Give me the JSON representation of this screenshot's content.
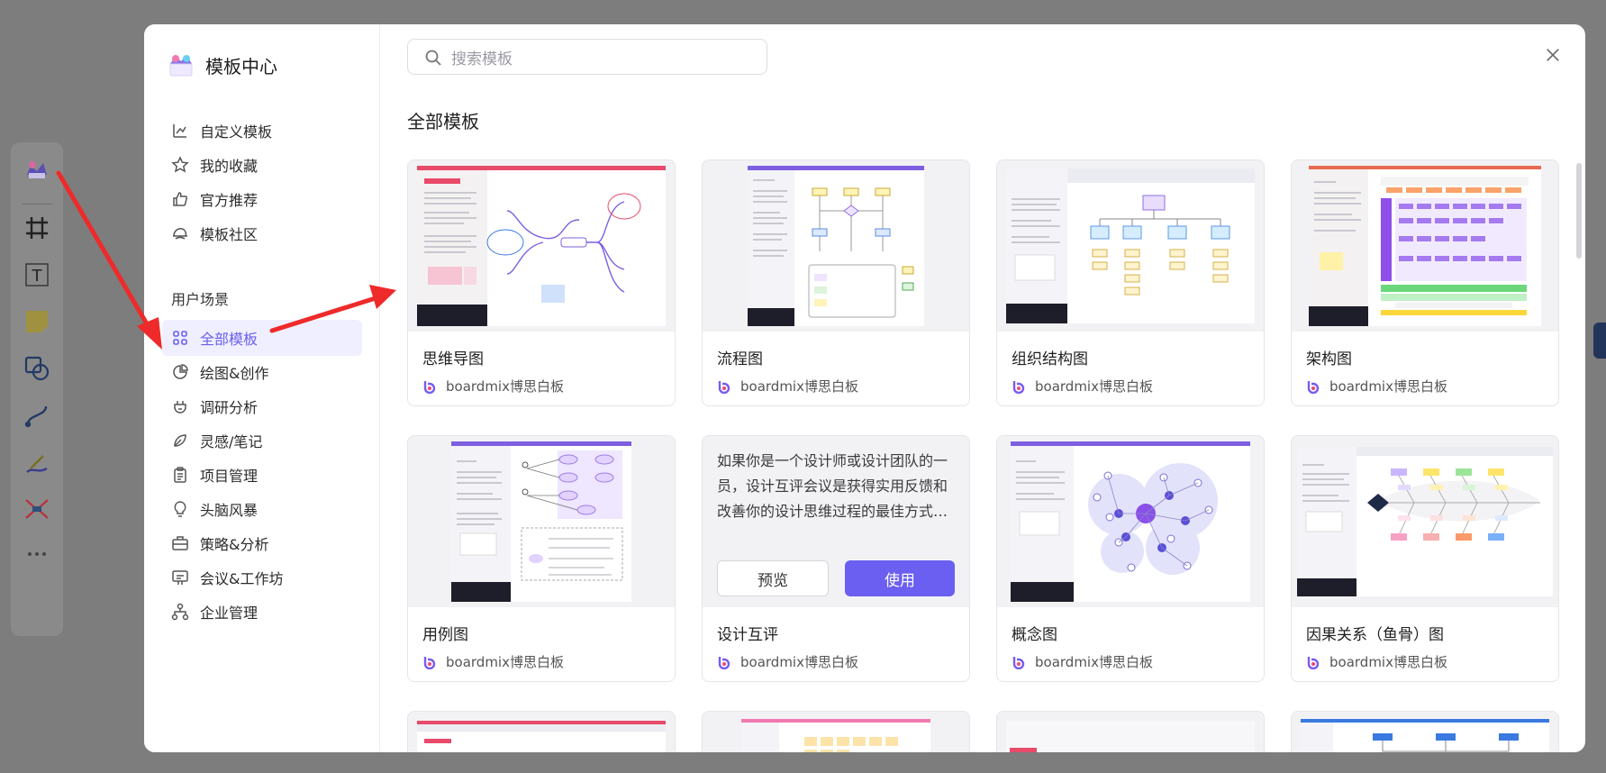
{
  "colors": {
    "accent": "#6a5ff0",
    "accent_bg": "#f0efff",
    "annotation_arrow": "#ee2a2a"
  },
  "toolbar": {
    "tools": [
      "template-icon",
      "frame-icon",
      "text-icon",
      "sticky-note-icon",
      "shape-icon",
      "connector-icon",
      "pen-icon",
      "mindmap-icon",
      "more-icon"
    ]
  },
  "modal": {
    "brand_title": "模板中心",
    "nav_top": [
      {
        "label": "自定义模板",
        "icon": "custom-template-icon"
      },
      {
        "label": "我的收藏",
        "icon": "star-icon"
      },
      {
        "label": "官方推荐",
        "icon": "thumbs-up-icon"
      },
      {
        "label": "模板社区",
        "icon": "community-icon"
      }
    ],
    "section_label": "用户场景",
    "nav_scenes": [
      {
        "label": "全部模板",
        "icon": "grid-icon",
        "active": true
      },
      {
        "label": "绘图&创作",
        "icon": "pie-icon"
      },
      {
        "label": "调研分析",
        "icon": "research-icon"
      },
      {
        "label": "灵感/笔记",
        "icon": "inspiration-icon"
      },
      {
        "label": "项目管理",
        "icon": "clipboard-icon"
      },
      {
        "label": "头脑风暴",
        "icon": "bulb-icon"
      },
      {
        "label": "策略&分析",
        "icon": "briefcase-icon"
      },
      {
        "label": "会议&工作坊",
        "icon": "meeting-icon"
      },
      {
        "label": "企业管理",
        "icon": "org-icon"
      }
    ],
    "search_placeholder": "搜索模板",
    "main_title": "全部模板",
    "cards": [
      {
        "title": "思维导图",
        "author": "boardmix博思白板"
      },
      {
        "title": "流程图",
        "author": "boardmix博思白板"
      },
      {
        "title": "组织结构图",
        "author": "boardmix博思白板"
      },
      {
        "title": "架构图",
        "author": "boardmix博思白板"
      },
      {
        "title": "用例图",
        "author": "boardmix博思白板"
      },
      {
        "title": "设计互评",
        "author": "boardmix博思白板",
        "description": "如果你是一个设计师或设计团队的一员，设计互评会议是获得实用反馈和改善你的设计思维过程的最佳方式之一...",
        "preview_label": "预览",
        "use_label": "使用"
      },
      {
        "title": "概念图",
        "author": "boardmix博思白板"
      },
      {
        "title": "因果关系（鱼骨）图",
        "author": "boardmix博思白板"
      }
    ]
  }
}
